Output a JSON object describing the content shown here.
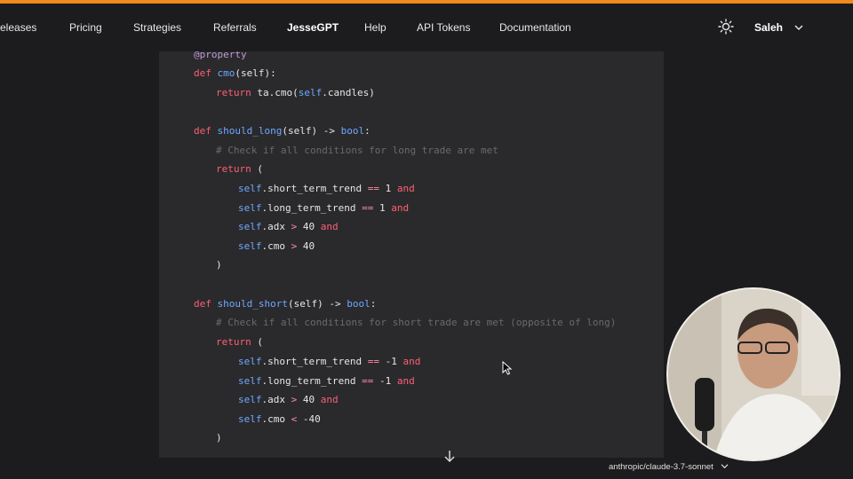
{
  "nav": {
    "items": [
      "eleases",
      "Pricing",
      "Strategies",
      "Referrals",
      "JesseGPT",
      "Help",
      "API Tokens",
      "Documentation"
    ],
    "active": "JesseGPT",
    "user": "Saleh"
  },
  "code": {
    "decorator": "@property",
    "cmo_def": "def cmo(self):",
    "cmo_return": "return ta.cmo(self.candles)",
    "long_def": "def should_long(self) -> bool:",
    "long_comment": "# Check if all conditions for long trade are met",
    "short_def": "def should_short(self) -> bool:",
    "short_comment": "# Check if all conditions for short trade are met (opposite of long)"
  },
  "footer": {
    "model": "anthropic/claude-3.7-sonnet"
  },
  "icons": {
    "theme": "sun-icon",
    "user_menu": "chevron-down-icon",
    "scroll": "arrow-down-icon",
    "model_menu": "chevron-down-icon"
  },
  "colors": {
    "accent": "#f08a1c",
    "keyword": "#ff5f73",
    "function": "#6fa8ff",
    "comment": "#6a6a6e"
  }
}
